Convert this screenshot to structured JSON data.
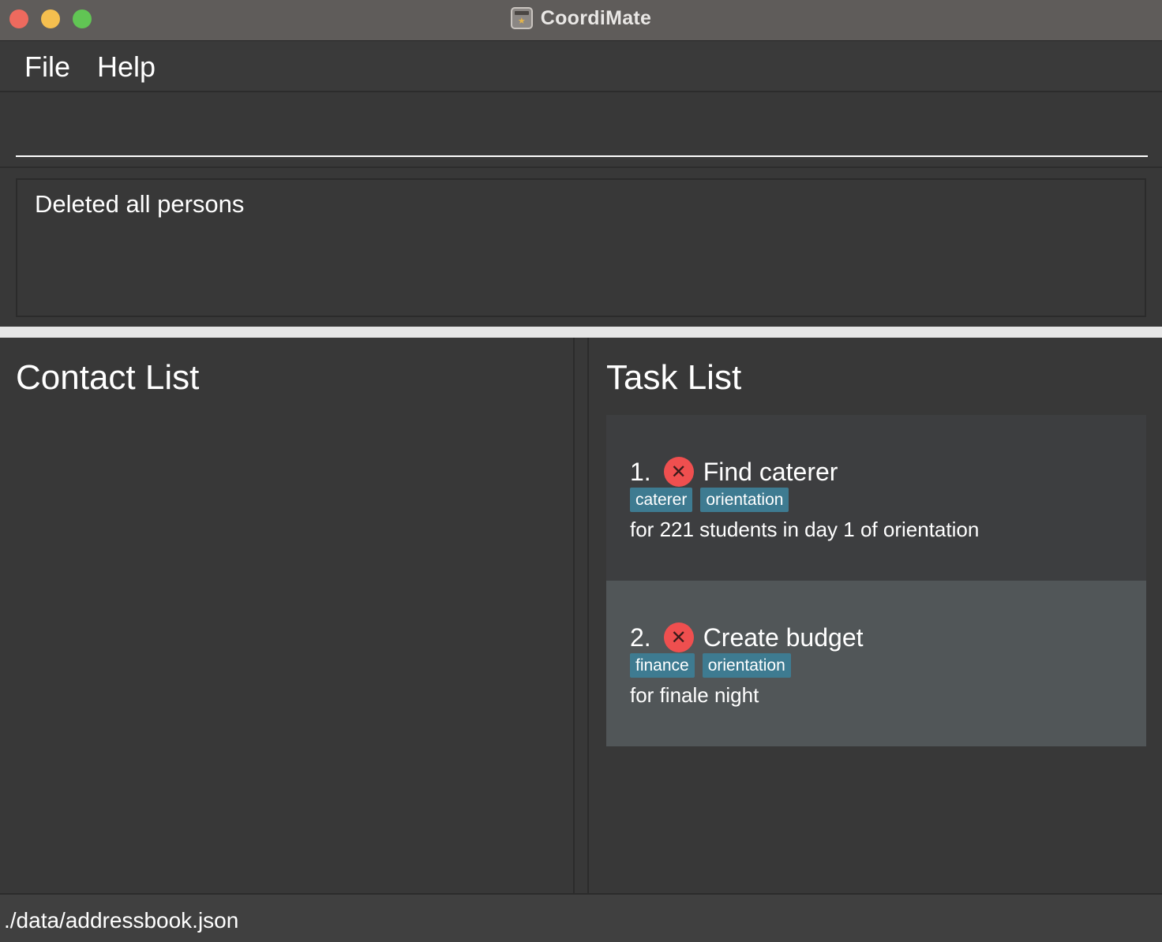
{
  "window": {
    "title": "CoordiMate",
    "app_icon": "calendar-icon"
  },
  "menu": {
    "file_label": "File",
    "help_label": "Help"
  },
  "command": {
    "value": "",
    "placeholder": ""
  },
  "result": {
    "message": "Deleted all persons"
  },
  "contacts": {
    "title": "Contact List",
    "items": []
  },
  "tasks": {
    "title": "Task List",
    "items": [
      {
        "index": "1.",
        "status_icon": "not-done-icon",
        "name": "Find caterer",
        "tags": [
          "caterer",
          "orientation"
        ],
        "description": "for 221 students in day 1 of orientation"
      },
      {
        "index": "2.",
        "status_icon": "not-done-icon",
        "name": "Create budget",
        "tags": [
          "finance",
          "orientation"
        ],
        "description": "for finale night"
      }
    ]
  },
  "status_bar": {
    "path": "./data/addressbook.json"
  },
  "colors": {
    "background": "#383838",
    "tag": "#3e7b91",
    "not_done": "#ef4f4f",
    "selected_card": "#515658"
  }
}
